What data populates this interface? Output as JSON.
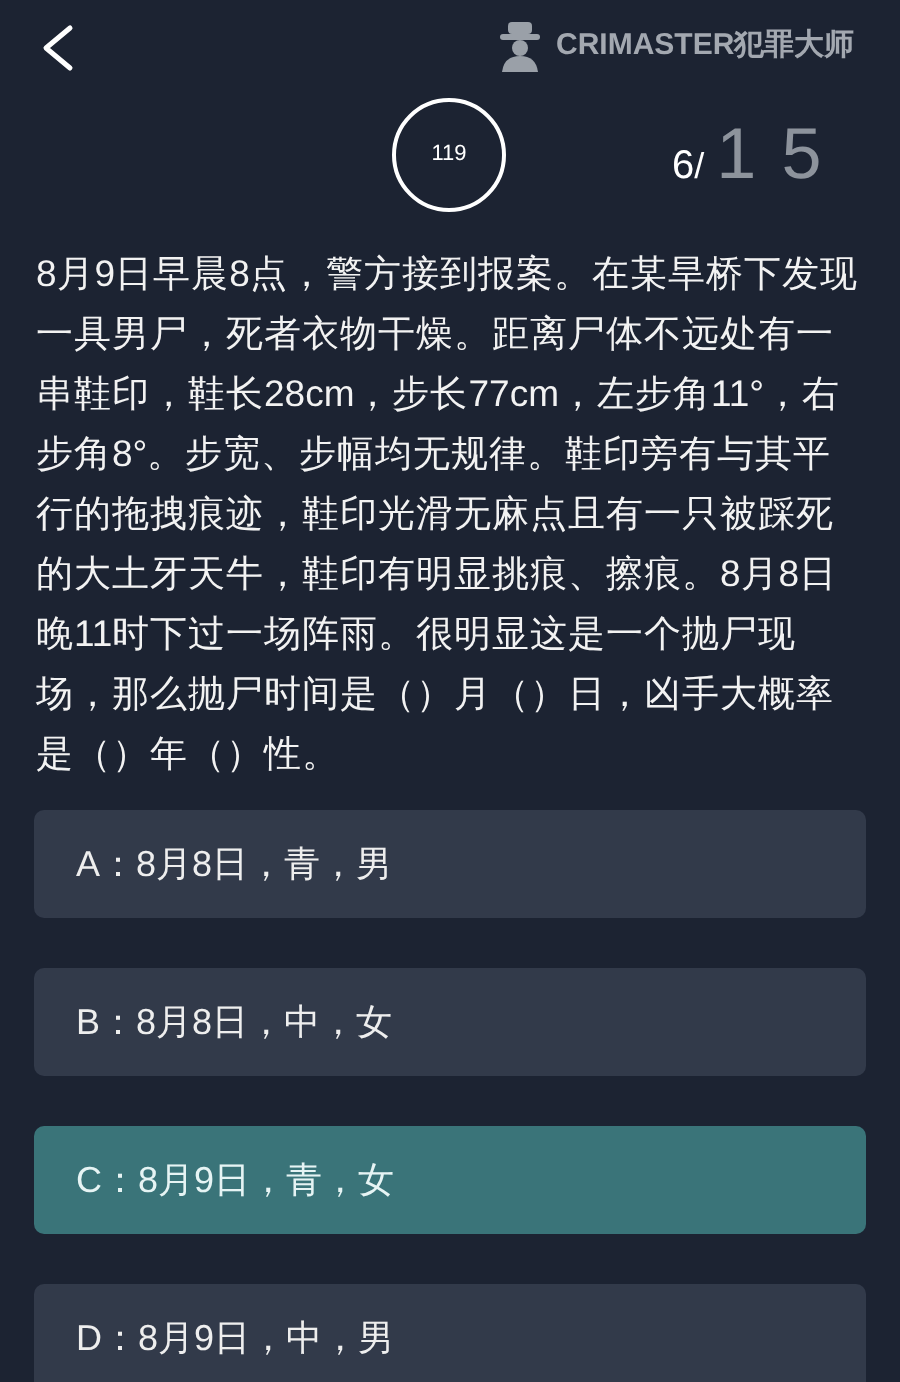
{
  "header": {
    "brand": "CRIMASTER犯罪大师"
  },
  "timer": {
    "value": "119"
  },
  "progress": {
    "current": "6",
    "separator": "/",
    "total": "15"
  },
  "question": "8月9日早晨8点，警方接到报案。在某旱桥下发现一具男尸，死者衣物干燥。距离尸体不远处有一串鞋印，鞋长28cm，步长77cm，左步角11°，右步角8°。步宽、步幅均无规律。鞋印旁有与其平行的拖拽痕迹，鞋印光滑无麻点且有一只被踩死的大土牙天牛，鞋印有明显挑痕、擦痕。8月8日晚11时下过一场阵雨。很明显这是一个抛尸现场，那么抛尸时间是（）月（）日，凶手大概率是（）年（）性。",
  "options": [
    {
      "label": "A：8月8日，青，男",
      "selected": false
    },
    {
      "label": "B：8月8日，中，女",
      "selected": false
    },
    {
      "label": "C：8月9日，青，女",
      "selected": true
    },
    {
      "label": "D：8月9日，中，男",
      "selected": false
    }
  ]
}
